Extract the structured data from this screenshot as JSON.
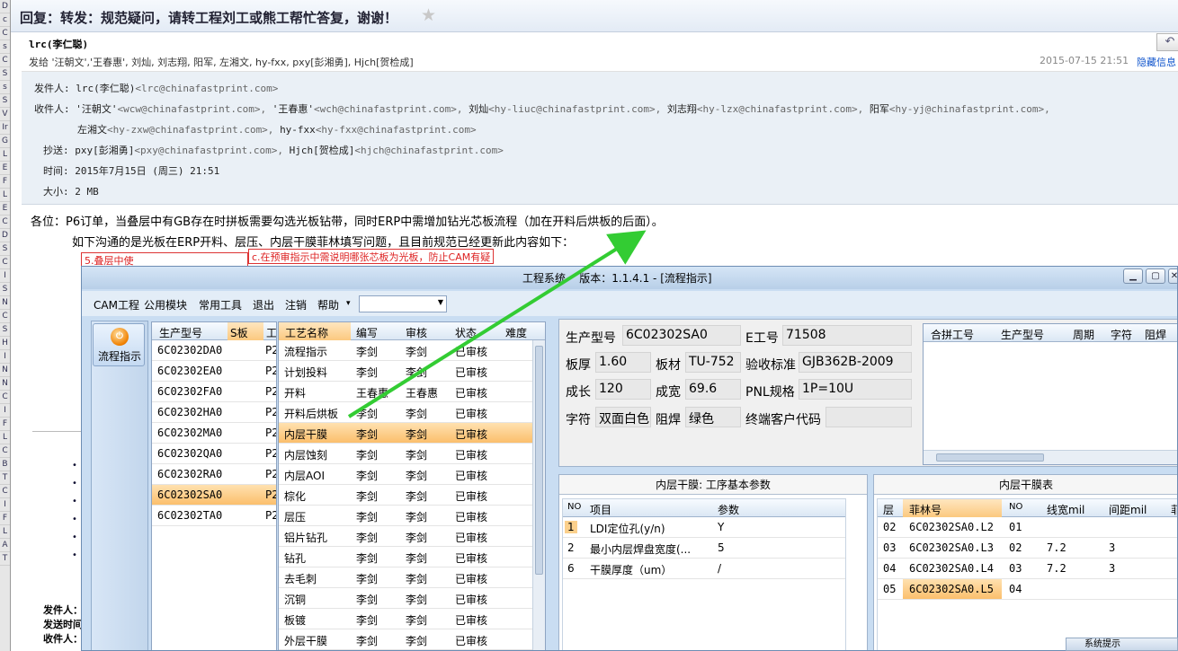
{
  "email": {
    "subject": "回复：转发：规范疑问，请转工程刘工或熊工帮忙答复，谢谢！",
    "sender": "lrc(李仁聪)",
    "sent_to": "发给 '汪朝文','王春惠', 刘灿, 刘志翔, 阳军, 左湘文, hy-fxx, pxy[彭湘勇], Hjch[贺检成]",
    "date": "2015-07-15 21:51",
    "hide_info": "隐藏信息",
    "from_label": "发件人:",
    "from_value": "lrc(李仁聪)",
    "from_email": "<lrc@chinafastprint.com>",
    "to_label": "收件人:",
    "to_line1": [
      {
        "n": "'汪朝文'",
        "e": "<wcw@chinafastprint.com>,"
      },
      {
        "n": "'王春惠'",
        "e": "<wch@chinafastprint.com>,"
      },
      {
        "n": "刘灿",
        "e": "<hy-liuc@chinafastprint.com>,"
      },
      {
        "n": "刘志翔",
        "e": "<hy-lzx@chinafastprint.com>,"
      },
      {
        "n": "阳军",
        "e": "<hy-yj@chinafastprint.com>,"
      }
    ],
    "to_line2": [
      {
        "n": "左湘文",
        "e": "<hy-zxw@chinafastprint.com>,"
      },
      {
        "n": "hy-fxx",
        "e": "<hy-fxx@chinafastprint.com>"
      }
    ],
    "cc_label": "抄送:",
    "cc": [
      {
        "n": "pxy[彭湘勇]",
        "e": "<pxy@chinafastprint.com>,"
      },
      {
        "n": "Hjch[贺检成]",
        "e": "<hjch@chinafastprint.com>"
      }
    ],
    "time_label": "时间:",
    "time_value": "2015年7月15日 (周三) 21:51",
    "size_label": "大小:",
    "size_value": "2 MB",
    "body_line1": "各位：P6订单，当叠层中有GB存在时拼板需要勾选光板钻带，同时ERP中需增加钻光芯板流程（加在开料后烘板的后面）。",
    "body_line2": "如下沟通的是光板在ERP开料、层压、内层干膜菲林填写问题，且目前规范已经更新此内容如下：",
    "red_note1": "5.叠层中使",
    "red_note2": "c.在预审指示中需说明哪张芯板为光板，防止CAM有疑",
    "bottom_labels": [
      "发件人：",
      "发送时间",
      "收件人："
    ]
  },
  "left_strip": [
    "D",
    "c",
    "C",
    "s",
    "C",
    "S",
    "s",
    "S",
    "V",
    "Ir",
    "G",
    "L",
    "E",
    "F",
    "L",
    "E",
    "C",
    "D",
    "S",
    "C",
    "I",
    "S",
    "N",
    "C",
    "S",
    "H",
    "I",
    "N",
    "N",
    "C",
    "I",
    "F",
    "L",
    "C",
    "B",
    "T",
    "C",
    "I",
    "F",
    "L",
    "A",
    "T"
  ],
  "window": {
    "title": "工程系统    版本：1.1.4.1 - [流程指示]",
    "menu": [
      "CAM工程",
      "公用模块",
      "常用工具",
      "退出",
      "注销",
      "帮助"
    ],
    "menu_arrow": "▾",
    "flow_button": "流程指示",
    "prod_table": {
      "headers": [
        "生产型号",
        "S板",
        "工"
      ],
      "rows": [
        "6C02302DA0",
        "6C02302EA0",
        "6C02302FA0",
        "6C02302HA0",
        "6C02302MA0",
        "6C02302QA0",
        "6C02302RA0",
        "6C02302SA0",
        "6C02302TA0"
      ],
      "p2": "P2",
      "selected_index": 7
    },
    "proc_table": {
      "headers": [
        "工艺名称",
        "编写",
        "审核",
        "状态",
        "难度"
      ],
      "rows": [
        [
          "流程指示",
          "李剑",
          "李剑",
          "已审核"
        ],
        [
          "计划投料",
          "李剑",
          "李剑",
          "已审核"
        ],
        [
          "开料",
          "王春惠",
          "王春惠",
          "已审核"
        ],
        [
          "开料后烘板",
          "李剑",
          "李剑",
          "已审核"
        ],
        [
          "内层干膜",
          "李剑",
          "李剑",
          "已审核"
        ],
        [
          "内层蚀刻",
          "李剑",
          "李剑",
          "已审核"
        ],
        [
          "内层AOI",
          "李剑",
          "李剑",
          "已审核"
        ],
        [
          "棕化",
          "李剑",
          "李剑",
          "已审核"
        ],
        [
          "层压",
          "李剑",
          "李剑",
          "已审核"
        ],
        [
          "铝片钻孔",
          "李剑",
          "李剑",
          "已审核"
        ],
        [
          "钻孔",
          "李剑",
          "李剑",
          "已审核"
        ],
        [
          "去毛刺",
          "李剑",
          "李剑",
          "已审核"
        ],
        [
          "沉铜",
          "李剑",
          "李剑",
          "已审核"
        ],
        [
          "板镀",
          "李剑",
          "李剑",
          "已审核"
        ],
        [
          "外层干膜",
          "李剑",
          "李剑",
          "已审核"
        ]
      ],
      "selected_index": 4
    },
    "info": {
      "prod_label": "生产型号",
      "prod_value": "6C02302SA0",
      "e_label": "E工号",
      "e_value": "71508",
      "thick_label": "板厚",
      "thick_value": "1.60",
      "mat_label": "板材",
      "mat_value": "TU-752",
      "std_label": "验收标准",
      "std_value": "GJB362B-2009",
      "len_label": "成长",
      "len_value": "120",
      "wid_label": "成宽",
      "wid_value": "69.6",
      "pnl_label": "PNL规格",
      "pnl_value": "1P=10U",
      "char_label": "字符",
      "char_value": "双面白色",
      "mask_label": "阻焊",
      "mask_value": "绿色",
      "cust_label": "终端客户代码",
      "cust_value": ""
    },
    "merge_table": {
      "headers": [
        "合拼工号",
        "生产型号",
        "周期",
        "字符",
        "阻焊"
      ]
    },
    "param_panel": {
      "title": "内层干膜: 工序基本参数",
      "headers": [
        "NO",
        "项目",
        "参数"
      ],
      "rows": [
        [
          "1",
          "LDI定位孔(y/n)",
          "Y"
        ],
        [
          "2",
          "最小内层焊盘宽度(...",
          "5"
        ],
        [
          "6",
          "干膜厚度（um）",
          "/"
        ]
      ]
    },
    "film_panel": {
      "title": "内层干膜表",
      "headers": [
        "层",
        "菲林号",
        "NO",
        "线宽mil",
        "间距mil",
        "菲"
      ],
      "rows": [
        [
          "02",
          "6C02302SA0.L2",
          "01",
          "",
          ""
        ],
        [
          "03",
          "6C02302SA0.L3",
          "02",
          "7.2",
          "3"
        ],
        [
          "04",
          "6C02302SA0.L4",
          "03",
          "7.2",
          "3"
        ],
        [
          "05",
          "6C02302SA0.L5",
          "04",
          "",
          ""
        ]
      ],
      "selected_index": 3
    },
    "system_hint": "系统提示"
  }
}
